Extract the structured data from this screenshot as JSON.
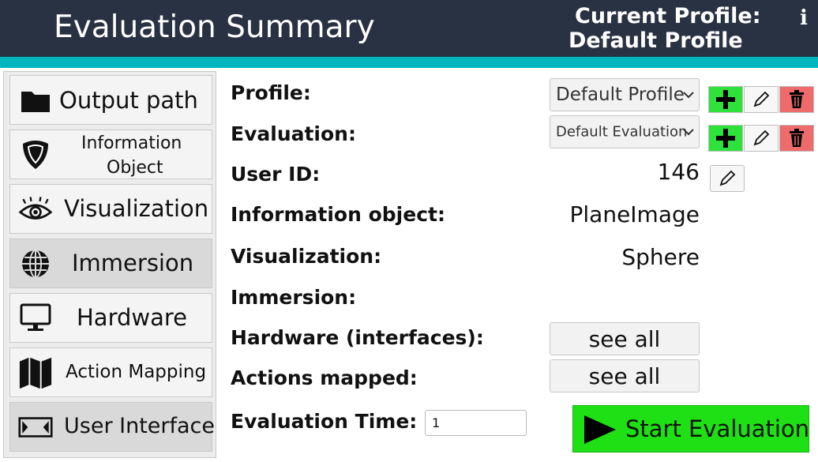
{
  "header": {
    "title": "Evaluation Summary",
    "profile_label": "Current Profile:",
    "profile_name": "Default Profile",
    "info_symbol": "i"
  },
  "sidebar": {
    "items": [
      {
        "label": "Output path",
        "icon": "folder-icon"
      },
      {
        "label_line1": "Information",
        "label_line2": "Object",
        "icon": "shield-icon"
      },
      {
        "label": "Visualization",
        "icon": "eye-icon"
      },
      {
        "label": "Immersion",
        "icon": "globe-icon",
        "selected": true
      },
      {
        "label": "Hardware",
        "icon": "monitor-icon"
      },
      {
        "label": "Action Mapping",
        "icon": "map-icon"
      },
      {
        "label": "User Interface",
        "icon": "frame-icon",
        "selected": true
      }
    ]
  },
  "form": {
    "profile_label": "Profile:",
    "profile_value": "Default Profile",
    "evaluation_label": "Evaluation:",
    "evaluation_value": "Default Evaluation",
    "user_id_label": "User ID:",
    "user_id_value": "146",
    "info_object_label": "Information object:",
    "info_object_value": "PlaneImage",
    "visualization_label": "Visualization:",
    "visualization_value": "Sphere",
    "immersion_label": "Immersion:",
    "immersion_value": "",
    "hardware_label": "Hardware (interfaces):",
    "hardware_button": "see all",
    "actions_label": "Actions mapped:",
    "actions_button": "see all",
    "time_label": "Evaluation Time:",
    "time_value": "1",
    "start_label": "Start Evaluation"
  },
  "colors": {
    "header_bg": "#283242",
    "accent": "#00b7c0",
    "add": "#2fe23b",
    "delete": "#ef6b6b",
    "start": "#1ee014"
  }
}
